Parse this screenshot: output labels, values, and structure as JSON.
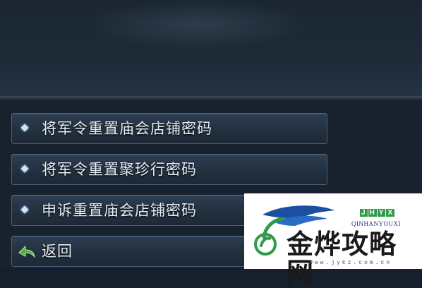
{
  "menu": {
    "items": [
      {
        "label": "将军令重置庙会店铺密码",
        "icon": "diamond-bullet"
      },
      {
        "label": "将军令重置聚珍行密码",
        "icon": "diamond-bullet"
      },
      {
        "label": "申诉重置庙会店铺密码",
        "icon": "diamond-bullet"
      }
    ],
    "back": {
      "label": "返回",
      "icon": "green-back-arrow"
    }
  },
  "watermark": {
    "brand_letters": [
      "J",
      "H",
      "Y",
      "X"
    ],
    "brand_name": "QINHANYOUXI",
    "title": "金烨攻略网",
    "url": "www.jykz.com.cn"
  },
  "colors": {
    "menu_text": "#e6eef5",
    "menu_border": "#4a6078",
    "back_arrow": "#4caf3a",
    "watermark_green": "#2f9a4a",
    "watermark_blue": "#1d3f84"
  }
}
